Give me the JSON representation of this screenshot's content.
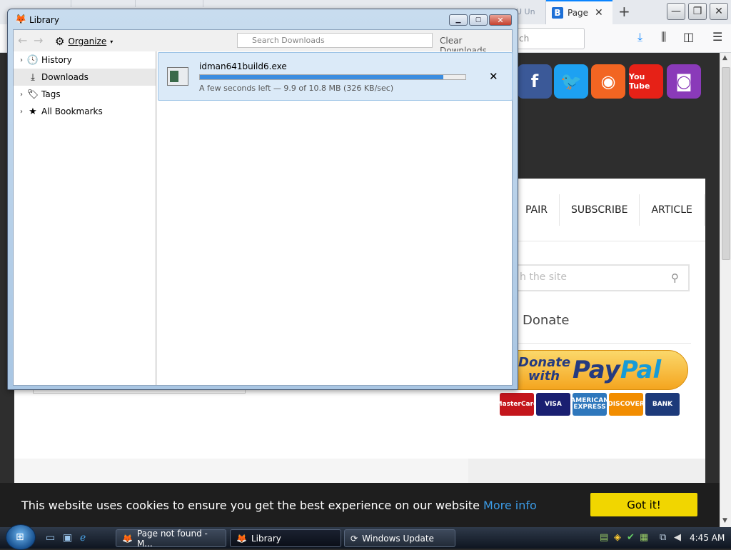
{
  "browser": {
    "tab_ghost_label": "U Un",
    "active_tab_title": "Page n",
    "active_tab_favicon": "B",
    "url_partial": "ch",
    "new_tab_symbol": "+",
    "minimize": "—",
    "restore": "❐",
    "close": "✕"
  },
  "site": {
    "social": [
      {
        "name": "facebook",
        "symbol": "f",
        "color": "#3b5998"
      },
      {
        "name": "twitter",
        "symbol": "🐦",
        "color": "#1da1f2"
      },
      {
        "name": "rss",
        "symbol": "◉",
        "color": "#f26522"
      },
      {
        "name": "youtube",
        "symbol": "You Tube",
        "color": "#e62117"
      },
      {
        "name": "instagram",
        "symbol": "◙",
        "color": "#8a3ab9"
      }
    ],
    "nav_items": [
      "PAIR",
      "SUBSCRIBE",
      "ARTICLE"
    ],
    "search_placeholder": "h the site",
    "donate_heading": "Donate",
    "paypal_donate": "Donate with",
    "paypal_brand_a": "Pay",
    "paypal_brand_b": "Pal",
    "cards": [
      {
        "label": "MasterCard",
        "color": "#c4161c"
      },
      {
        "label": "VISA",
        "color": "#1a1f71"
      },
      {
        "label": "AMERICAN EXPRESS",
        "color": "#2e77bc"
      },
      {
        "label": "DISCOVER",
        "color": "#f28d00"
      },
      {
        "label": "BANK",
        "color": "#1d3a7a"
      }
    ]
  },
  "cookie": {
    "text": "This website uses cookies to ensure you get the best experience on our website",
    "more_info": "More info",
    "button": "Got it!"
  },
  "library": {
    "title": "Library",
    "organize": "Organize",
    "search_placeholder": "Search Downloads",
    "clear_downloads": "Clear Downloads",
    "sidebar": [
      {
        "label": "History",
        "icon": "🕓",
        "twisty": "›",
        "selected": false
      },
      {
        "label": "Downloads",
        "icon": "⤓",
        "twisty": "",
        "selected": true
      },
      {
        "label": "Tags",
        "icon": "🏷",
        "twisty": "›",
        "selected": false
      },
      {
        "label": "All Bookmarks",
        "icon": "★",
        "twisty": "›",
        "selected": false
      }
    ],
    "download": {
      "filename": "idman641build6.exe",
      "status": "A few seconds left — 9.9 of 10.8 MB (326 KB/sec)",
      "progress": 0.917,
      "cancel": "✕"
    }
  },
  "taskbar": {
    "tasks": [
      {
        "label": "Page not found - M...",
        "active": false
      },
      {
        "label": "Library",
        "active": true
      },
      {
        "label": "Windows Update",
        "active": false
      }
    ],
    "clock": "4:45 AM"
  }
}
